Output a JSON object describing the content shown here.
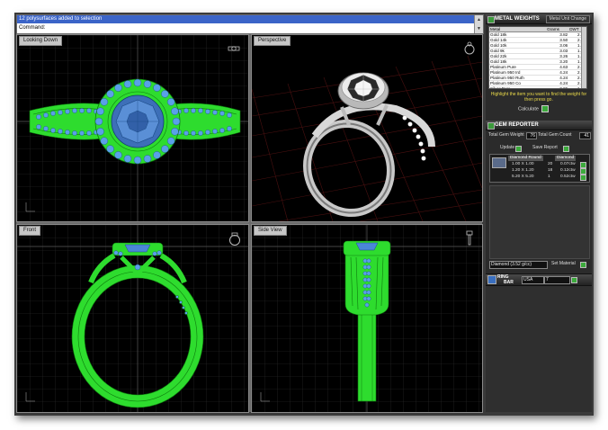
{
  "command_line": {
    "line1": "12 polysurfaces added to selection",
    "line2": "Command:"
  },
  "viewports": {
    "top_left": {
      "title": "Looking Down"
    },
    "top_right": {
      "title": "Perspective"
    },
    "bottom_left": {
      "title": "Front"
    },
    "bottom_right": {
      "title": "Side View"
    }
  },
  "metal_weights": {
    "title": "METAL WEIGHTS",
    "header_button": "Metal Unit Change",
    "columns": [
      "Metal",
      "Grams",
      "DWT"
    ],
    "rows": [
      [
        "Gold 18k",
        "3.82",
        "2.46"
      ],
      [
        "Gold 14k",
        "3.50",
        "2.25"
      ],
      [
        "Gold 10k",
        "3.06",
        "1.97"
      ],
      [
        "Gold 9k",
        "3.03",
        "1.95"
      ],
      [
        "Gold 22k",
        "3.26",
        "1.77"
      ],
      [
        "Gold 18k",
        "3.20",
        "1.54"
      ],
      [
        "Platinum Pure",
        "4.63",
        "2.97"
      ],
      [
        "Platinum 950 Ird",
        "4.24",
        "2.73"
      ],
      [
        "Platinum 950 Ruth",
        "4.24",
        "2.73"
      ],
      [
        "Platinum 950 Co",
        "4.24",
        "2.73"
      ],
      [
        "Silver Pure",
        "2.06",
        "1.33"
      ],
      [
        "Silver Sterling .92",
        "2.01",
        "1.30"
      ]
    ],
    "hint": "Highlight the item you want to find the weight for then press go.",
    "calculate_label": "Calculate"
  },
  "gem_reporter": {
    "title": "GEM REPORTER",
    "total_gem_weight_label": "Total Gem Weight",
    "total_gem_weight_value": "76",
    "total_gem_count_label": "Total Gem Count",
    "total_gem_count_value": "41",
    "update_label": "Update",
    "save_report_label": "Save Report",
    "table": {
      "col_shape": "Diamond Round",
      "col_type": "Diamond",
      "rows": [
        {
          "size": "1.00 X 1.00",
          "count": "20",
          "weight": "0.07ctw"
        },
        {
          "size": "1.20 X 1.20",
          "count": "18",
          "weight": "0.12ctw"
        },
        {
          "size": "5.20 X 5.20",
          "count": "1",
          "weight": "0.52ctw"
        }
      ]
    },
    "material_select": "Diamond (3.52 g/cc)",
    "set_material_label": "Set Material"
  },
  "ring_bar": {
    "label_top": "RING",
    "label_bottom": "BAR",
    "region_select": "USA",
    "size_select": "7"
  },
  "colors": {
    "ring_wireframe": "#2edc2e",
    "gems": "#5aa0e8",
    "viewport_bg": "#000000",
    "grid": "#3a3a3a"
  }
}
